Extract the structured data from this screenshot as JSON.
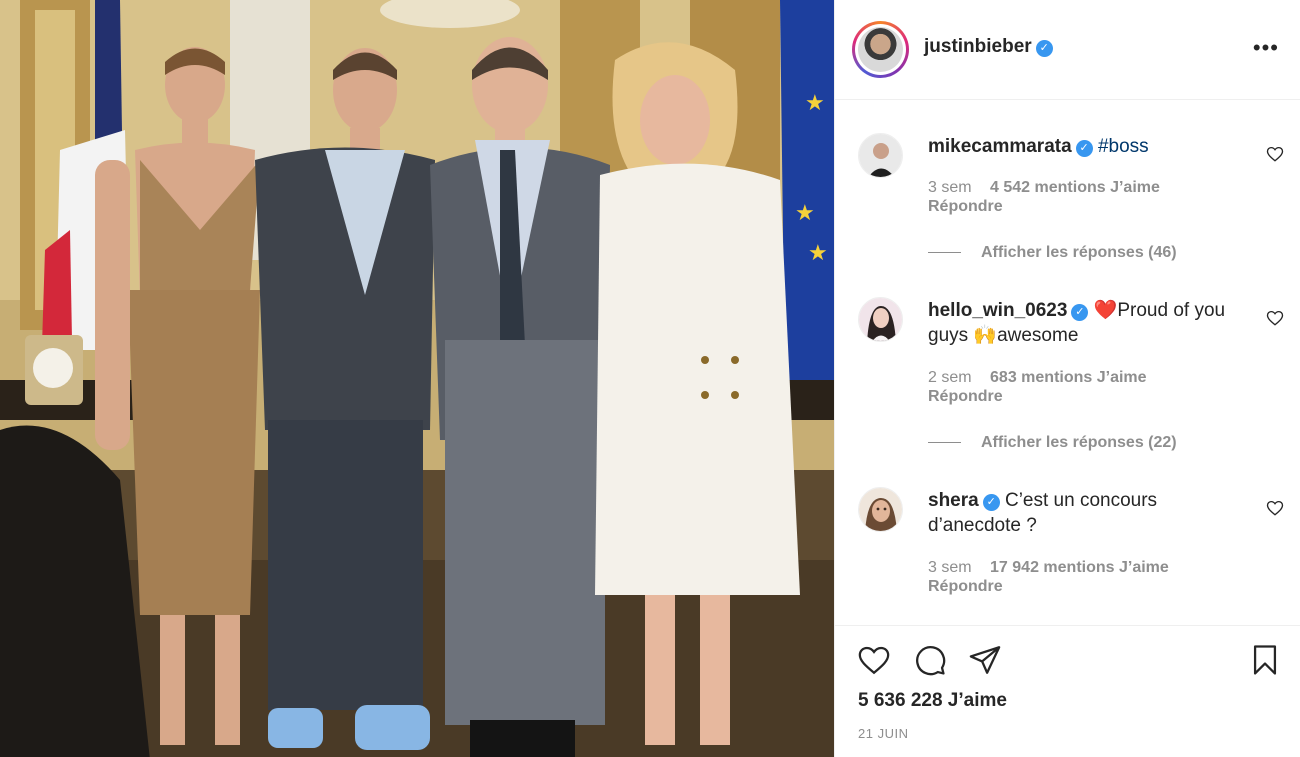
{
  "post": {
    "owner": "justinbieber",
    "owner_verified": true,
    "more_icon": "more-horizontal-icon",
    "likes_total": "5 636 228 J’aime",
    "date": "21 JUIN"
  },
  "comments": [
    {
      "user": "mikecammarata",
      "verified": true,
      "text": "",
      "hashtag": "#boss",
      "time": "3 sem",
      "likes": "4 542 mentions J’aime",
      "reply_label": "Répondre",
      "view_replies": "Afficher les réponses (46)"
    },
    {
      "user": "hello_win_0623",
      "verified": true,
      "text": "❤️Proud of you guys 🙌awesome",
      "hashtag": "",
      "time": "2 sem",
      "likes": "683 mentions J’aime",
      "reply_label": "Répondre",
      "view_replies": "Afficher les réponses (22)"
    },
    {
      "user": "shera",
      "verified": true,
      "text": "C’est un concours d’anecdote ?",
      "hashtag": "",
      "time": "3 sem",
      "likes": "17 942 mentions J’aime",
      "reply_label": "Répondre",
      "view_replies": ""
    }
  ],
  "actions": {
    "like_icon": "heart-icon",
    "comment_icon": "comment-icon",
    "share_icon": "send-icon",
    "save_icon": "bookmark-icon"
  },
  "colors": {
    "verified_blue": "#3897f0",
    "text_primary": "#262626",
    "text_secondary": "#8e8e8e",
    "hashtag": "#00376b",
    "border": "#efefef"
  }
}
